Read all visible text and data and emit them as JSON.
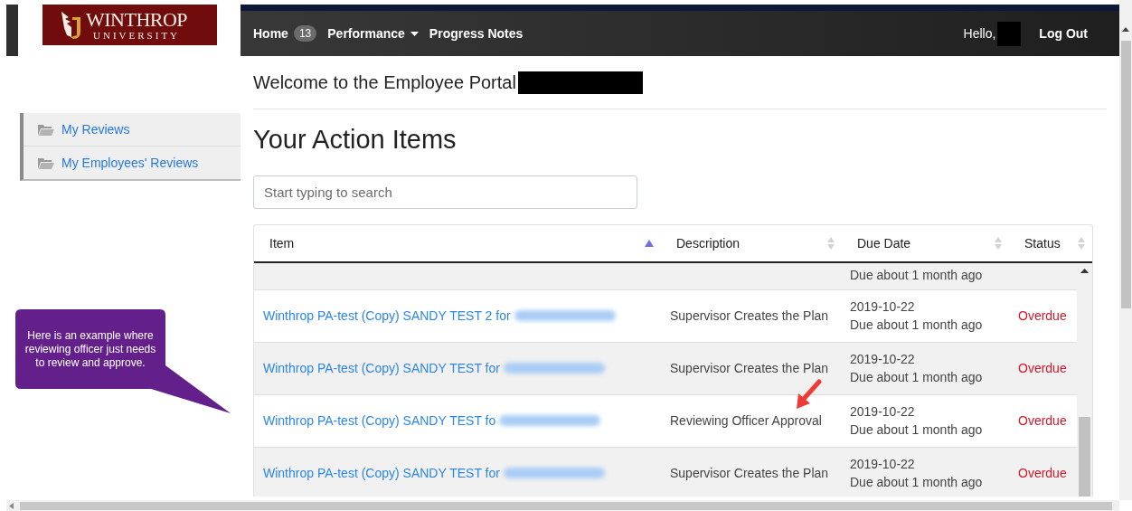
{
  "logo": {
    "name": "WINTHROP",
    "subtitle": "UNIVERSITY"
  },
  "navbar": {
    "items": [
      {
        "label": "Home",
        "kind": "badge",
        "badge": "13"
      },
      {
        "label": "Performance",
        "kind": "dropdown"
      },
      {
        "label": "Progress Notes",
        "kind": "link"
      }
    ],
    "greeting": "Hello,",
    "logout": "Log Out"
  },
  "sidebar": {
    "items": [
      {
        "label": "My Reviews"
      },
      {
        "label": "My Employees' Reviews"
      }
    ]
  },
  "welcome": "Welcome to the Employee Portal",
  "heading": "Your Action Items",
  "search": {
    "placeholder": "Start typing to search"
  },
  "table": {
    "columns": [
      {
        "label": "Item",
        "sorted": true
      },
      {
        "label": "Description",
        "sorted": false
      },
      {
        "label": "Due Date",
        "sorted": false
      },
      {
        "label": "Status",
        "sorted": false
      }
    ],
    "rows": [
      {
        "kind": "clipped",
        "due_relative": "Due about 1 month ago"
      },
      {
        "kind": "full",
        "item": "Winthrop PA-test (Copy) SANDY TEST 2 for",
        "name_blurred": true,
        "description": "Supervisor Creates the Plan",
        "due_date": "2019-10-22",
        "due_relative": "Due about 1 month ago",
        "status": "Overdue",
        "annotated": false
      },
      {
        "kind": "full",
        "item": "Winthrop PA-test (Copy) SANDY TEST for",
        "name_blurred": true,
        "description": "Supervisor Creates the Plan",
        "due_date": "2019-10-22",
        "due_relative": "Due about 1 month ago",
        "status": "Overdue",
        "annotated": false
      },
      {
        "kind": "full",
        "item": "Winthrop PA-test (Copy) SANDY TEST fo",
        "name_blurred": true,
        "description": "Reviewing Officer Approval",
        "due_date": "2019-10-22",
        "due_relative": "Due about 1 month ago",
        "status": "Overdue",
        "annotated": true
      },
      {
        "kind": "full",
        "item": "Winthrop PA-test (Copy) SANDY TEST for",
        "name_blurred": true,
        "description": "Supervisor Creates the Plan",
        "due_date": "2019-10-22",
        "due_relative": "Due about 1 month ago",
        "status": "Overdue",
        "annotated": false
      }
    ]
  },
  "callout": {
    "text": "Here is an example where reviewing officer just needs to review and approve."
  }
}
